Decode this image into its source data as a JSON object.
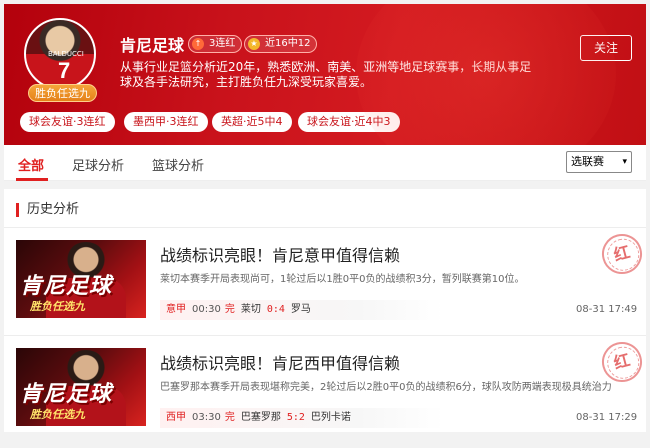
{
  "profile": {
    "name": "肯尼足球",
    "avatar_jersey": "7",
    "avatar_shirt_name": "BALDUCCI",
    "avatar_badge": "胜负任选九",
    "streak_tag": "3连红",
    "streak_icon": "↑",
    "recent_tag": "近16中12",
    "recent_icon": "★",
    "description": "从事行业足篮分析近20年，熟悉欧洲、南美、亚洲等地足球赛事，长期从事足球及各手法研究，主打胜负任九深受玩家喜爱。",
    "follow_label": "关注",
    "chips": [
      "球会友谊·3连红",
      "墨西甲·3连红",
      "英超·近5中4",
      "球会友谊·近4中3"
    ]
  },
  "tabs": [
    "全部",
    "足球分析",
    "篮球分析"
  ],
  "league_select": {
    "selected": "选联赛",
    "caret": "▾"
  },
  "section_title": "历史分析",
  "articles": [
    {
      "title": "战绩标识亮眼！肯尼意甲值得信赖",
      "summary": "莱切本赛季开局表现尚可，1轮过后以1胜0平0负的战绩积3分，暂列联赛第10位。",
      "thumb_title": "肯尼足球",
      "thumb_sub": "胜负任选九",
      "league": "意甲",
      "time": "00:30",
      "status": "完",
      "home": "莱切",
      "score": "0:4",
      "away": "罗马",
      "date": "08-31 17:49",
      "stamp": "红"
    },
    {
      "title": "战绩标识亮眼！肯尼西甲值得信赖",
      "summary": "巴塞罗那本赛季开局表现堪称完美，2轮过后以2胜0平0负的战绩积6分，球队攻防两端表现极具统治力",
      "thumb_title": "肯尼足球",
      "thumb_sub": "胜负任选九",
      "league": "西甲",
      "time": "03:30",
      "status": "完",
      "home": "巴塞罗那",
      "score": "5:2",
      "away": "巴列卡诺",
      "date": "08-31 17:29",
      "stamp": "红"
    }
  ],
  "colors": {
    "brand_red": "#e02020",
    "banner_red": "#c9121b",
    "badge_orange": "#e58119"
  }
}
